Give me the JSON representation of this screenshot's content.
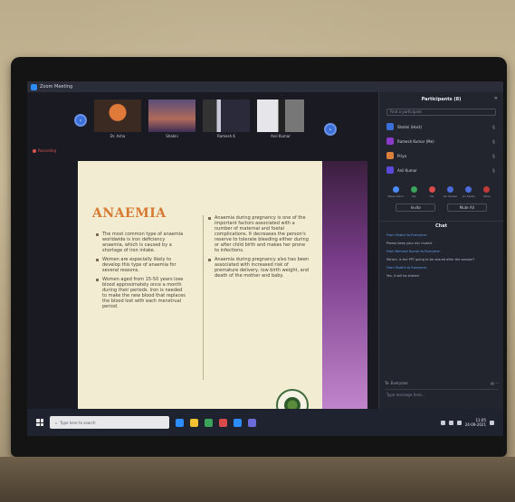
{
  "app": {
    "title": "Zoom Meeting"
  },
  "recording": {
    "label": "Recording"
  },
  "participants_strip": [
    {
      "name": "Dr. Asha"
    },
    {
      "name": "Shalini"
    },
    {
      "name": "Ramesh K"
    },
    {
      "name": "Anil Kumar"
    }
  ],
  "slide": {
    "title": "ANAEMIA",
    "left_bullets": [
      "The most common type of anaemia worldwide is iron deficiency anaemia, which is caused by a shortage of iron intake.",
      "Women are especially likely to develop this type of anaemia for several reasons.",
      "Women aged from 15-50 years lose blood approximately once a month during their periods. Iron is needed to make the new blood that replaces the blood lost with each menstrual period."
    ],
    "right_bullets": [
      "Anaemia during pregnancy is one of the important factors associated with a number of maternal and foetal complications. It decreases the person's reserve to tolerate bleeding either during or after child birth and makes her prone to infections.",
      "Anaemia during pregnancy also has been associated with increased risk of premature delivery, low birth weight, and death of the mother and baby."
    ]
  },
  "panel": {
    "title": "Participants (8)",
    "search_placeholder": "Find a participant",
    "participants": [
      {
        "name": "Shalini (Host)",
        "color": "#3a6fd9"
      },
      {
        "name": "Ramesh Kumar (Me)",
        "color": "#8c3ac9"
      },
      {
        "name": "Priya",
        "color": "#d9803a"
      },
      {
        "name": "Anil Kumar",
        "color": "#5a4ad9"
      }
    ],
    "controls": [
      {
        "label": "Raise Hand",
        "color": "#4a8cff"
      },
      {
        "label": "Yes",
        "color": "#3aa55a"
      },
      {
        "label": "No",
        "color": "#d94a4a"
      },
      {
        "label": "Go Slower",
        "color": "#4a6cd9"
      },
      {
        "label": "Go Faster",
        "color": "#4a6cd9"
      },
      {
        "label": "More",
        "color": "#c23a3a"
      }
    ],
    "invite_label": "Invite",
    "mute_all_label": "Mute All",
    "chat_title": "Chat",
    "messages": [
      {
        "from": "From Shalini to Everyone:",
        "text": "Please keep your mic muted."
      },
      {
        "from": "From Ramesh Kumar to Everyone:",
        "text": "Ma'am, is the PPT going to be shared after the session?"
      },
      {
        "from": "From Shalini to Everyone:",
        "text": "Yes, it will be shared."
      }
    ],
    "to_label": "To: Everyone",
    "chat_placeholder": "Type message here..."
  },
  "taskbar": {
    "search_placeholder": "Type here to search",
    "time": "11:05",
    "date": "24-09-2021",
    "app_colors": [
      "#2d8cff",
      "#f2c230",
      "#3aa55a",
      "#d94a4a",
      "#2d8cff",
      "#6b6bd9"
    ]
  }
}
